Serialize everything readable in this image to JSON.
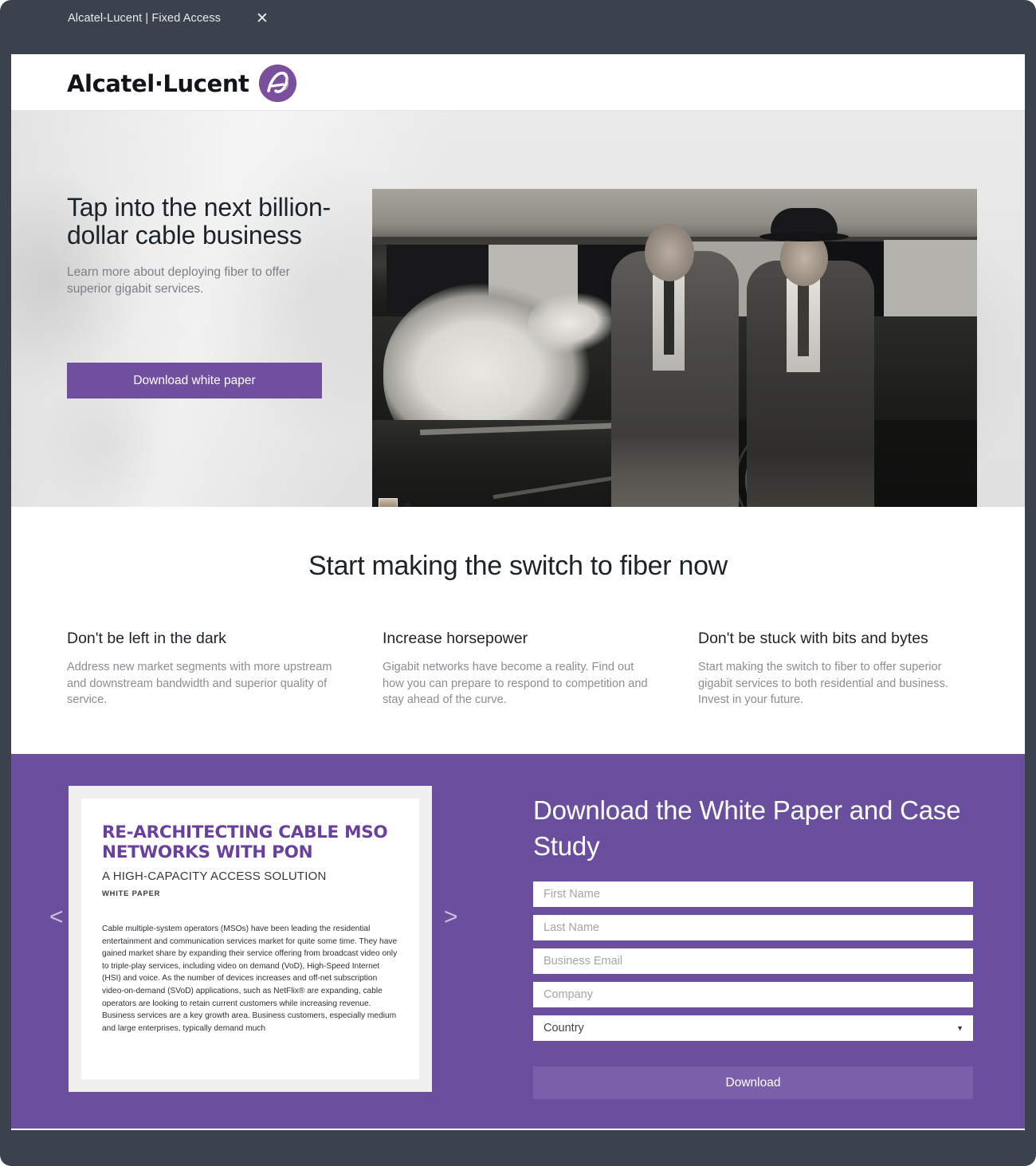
{
  "browser": {
    "tab_title": "Alcatel-Lucent | Fixed Access",
    "close_label": "✕"
  },
  "header": {
    "brand_wordmark": "Alcatel·Lucent",
    "brand_mark_icon": "alcatel-lucent-logo-icon"
  },
  "hero": {
    "title": "Tap into the next billion-dollar cable business",
    "subtitle": "Learn more about deploying fiber to offer superior gigabit services.",
    "cta_label": "Download white paper",
    "video_alt": "video-player"
  },
  "benefits": {
    "title": "Start making the switch to fiber now",
    "columns": [
      {
        "heading": "Don't be left in the dark",
        "body": "Address new market segments with more upstream and downstream bandwidth and superior quality of service."
      },
      {
        "heading": "Increase horsepower",
        "body": "Gigabit networks have become a reality. Find out how you can prepare to respond to competition and stay ahead of the curve."
      },
      {
        "heading": "Don't be stuck with bits and bytes",
        "body": "Start making the switch to fiber to offer superior gigabit services to both residential and business. Invest in your future."
      }
    ]
  },
  "download": {
    "form_title": "Download the White Paper and Case Study",
    "fields": [
      {
        "name": "first-name",
        "placeholder": "First Name",
        "value": ""
      },
      {
        "name": "last-name",
        "placeholder": "Last Name",
        "value": ""
      },
      {
        "name": "business-email",
        "placeholder": "Business Email",
        "value": ""
      },
      {
        "name": "company",
        "placeholder": "Company",
        "value": ""
      }
    ],
    "country_select": {
      "selected": "Country",
      "caret_icon": "chevron-down-icon"
    },
    "submit_label": "Download",
    "carousel": {
      "prev_icon": "chevron-left-icon",
      "next_icon": "chevron-right-icon",
      "prev_label": "<",
      "next_label": ">"
    },
    "white_paper": {
      "title": "RE-ARCHITECTING CABLE MSO NETWORKS WITH PON",
      "subtitle": "A HIGH-CAPACITY ACCESS SOLUTION",
      "kicker": "WHITE PAPER",
      "paragraph": "Cable multiple-system operators (MSOs) have been leading the residential entertainment and communication services market for quite some time. They have gained market share by expanding their service offering from broadcast video only to triple-play services, including video on demand (VoD), High-Speed Internet (HSI) and voice. As the number of devices increases and off-net subscription video-on-demand (SVoD) applications, such as NetFlix® are expanding, cable operators are looking to retain current customers while increasing revenue. Business services are a key growth area. Business customers, especially medium and large enterprises, typically demand much"
    }
  },
  "colors": {
    "brand_purple": "#6a4f9e",
    "cta_purple": "#6f4f9e",
    "submit_purple": "#7c5fab",
    "wp_title_purple": "#6a3f9d",
    "browser_chrome": "#3a424e",
    "hero_bg": "#e7e7e7",
    "body_text": "#8a8d91",
    "heading_text": "#1c2329"
  }
}
